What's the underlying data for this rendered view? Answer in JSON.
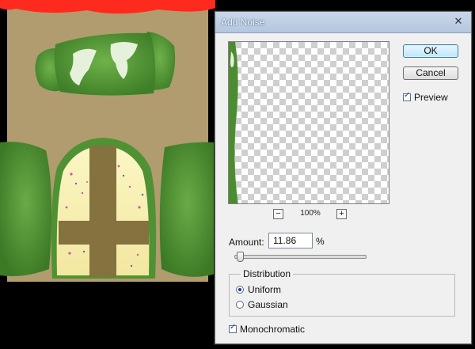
{
  "dialog": {
    "title": "Add Noise",
    "close_glyph": "✕",
    "ok_label": "OK",
    "cancel_label": "Cancel",
    "preview_label": "Preview",
    "preview_checked": true,
    "zoom": {
      "minus_glyph": "−",
      "plus_glyph": "+",
      "level": "100%"
    },
    "amount": {
      "label": "Amount:",
      "value": "11.86",
      "unit": "%",
      "slider_fraction": 0.03
    },
    "distribution": {
      "label": "Distribution",
      "options": [
        {
          "label": "Uniform",
          "selected": true
        },
        {
          "label": "Gaussian",
          "selected": false
        }
      ]
    },
    "monochromatic": {
      "label": "Monochromatic",
      "checked": true
    }
  },
  "colors": {
    "canvas_background": "#b09c6e",
    "leaf_green": "#4f9233",
    "leaf_light": "#e6f1dc",
    "border_red": "#ff2a1e",
    "dialog_bg": "#f0f0f0",
    "titlebar": "#bfd0e6"
  },
  "icons": {
    "close": "close-icon",
    "zoom_out": "minus-icon",
    "zoom_in": "plus-icon"
  }
}
